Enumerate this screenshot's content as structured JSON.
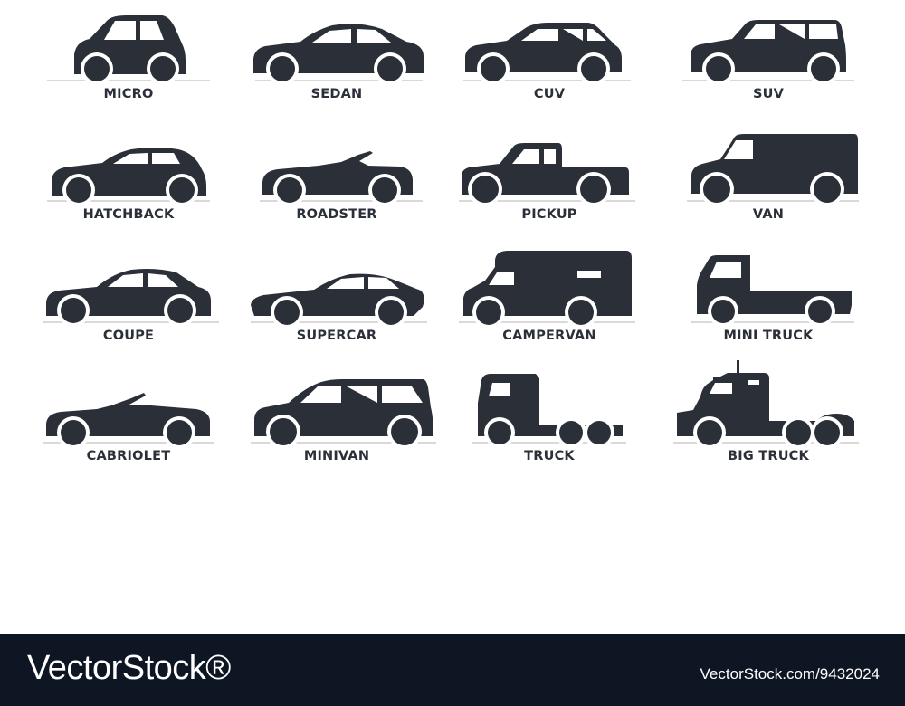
{
  "colors": {
    "silhouette": "#2b2f38",
    "ground": "#d9d9d9",
    "footer_bg": "#0e1624",
    "footer_text": "#ffffff"
  },
  "vehicles": [
    {
      "label": "MICRO",
      "icon": "micro-car-icon"
    },
    {
      "label": "SEDAN",
      "icon": "sedan-car-icon"
    },
    {
      "label": "CUV",
      "icon": "cuv-car-icon"
    },
    {
      "label": "SUV",
      "icon": "suv-car-icon"
    },
    {
      "label": "HATCHBACK",
      "icon": "hatchback-car-icon"
    },
    {
      "label": "ROADSTER",
      "icon": "roadster-car-icon"
    },
    {
      "label": "PICKUP",
      "icon": "pickup-truck-icon"
    },
    {
      "label": "VAN",
      "icon": "van-icon"
    },
    {
      "label": "COUPE",
      "icon": "coupe-car-icon"
    },
    {
      "label": "SUPERCAR",
      "icon": "supercar-icon"
    },
    {
      "label": "CAMPERVAN",
      "icon": "campervan-icon"
    },
    {
      "label": "MINI TRUCK",
      "icon": "mini-truck-icon"
    },
    {
      "label": "CABRIOLET",
      "icon": "cabriolet-car-icon"
    },
    {
      "label": "MINIVAN",
      "icon": "minivan-icon"
    },
    {
      "label": "TRUCK",
      "icon": "truck-icon"
    },
    {
      "label": "BIG TRUCK",
      "icon": "big-truck-icon"
    }
  ],
  "footer": {
    "brand": "VectorStock®",
    "url": "VectorStock.com/9432024"
  }
}
